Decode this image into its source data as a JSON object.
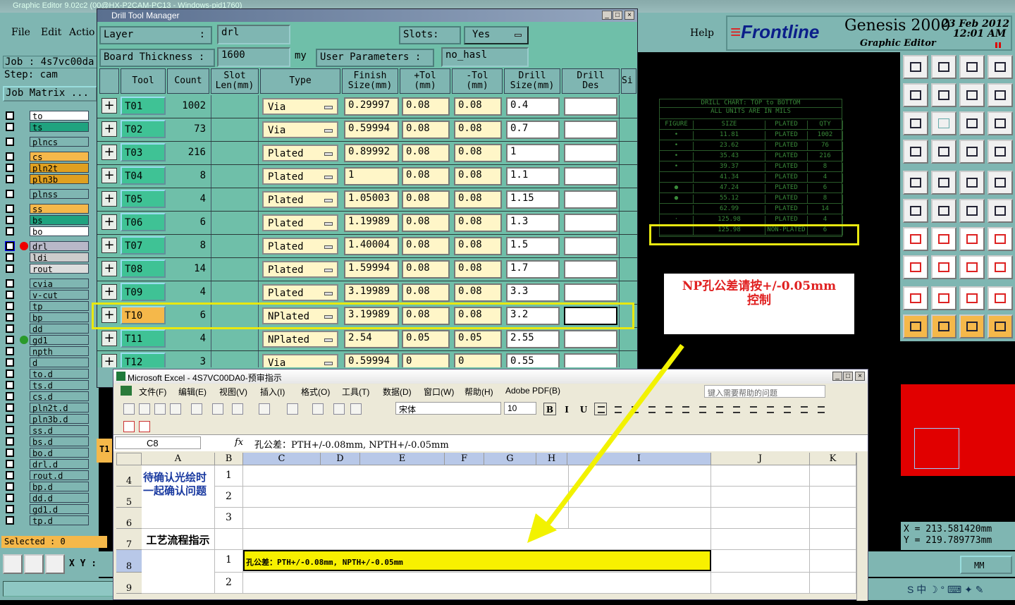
{
  "genesis": {
    "title": "Graphic Editor 9.02c2 (00@HX-P2CAM-PC13 - Windows-pid1760)",
    "menu": [
      "File",
      "Edit",
      "Actio"
    ],
    "help": "Help",
    "brand": {
      "logo": "Frontline",
      "product": "Genesis 2000",
      "sub": "Graphic Editor",
      "date": "23 Feb 2012",
      "time": "12:01 AM"
    },
    "job": "Job : 4s7vc00da",
    "step": "Step: cam",
    "job_matrix": "Job Matrix ...",
    "layers": [
      "to",
      "ts",
      "plncs",
      "cs",
      "pln2t",
      "pln3b",
      "plnss",
      "ss",
      "bs",
      "bo",
      "drl",
      "ldi",
      "rout",
      "cvia",
      "v-cut",
      "tp",
      "bp",
      "dd",
      "gd1",
      "npth",
      "d",
      "to.d",
      "ts.d",
      "cs.d",
      "pln2t.d",
      "pln3b.d",
      "ss.d",
      "bs.d",
      "bo.d",
      "drl.d",
      "rout.d",
      "bp.d",
      "dd.d",
      "gd1.d",
      "tp.d"
    ],
    "selected": "Selected : 0",
    "xy_label": "X Y :",
    "coords": {
      "x": "X  =  213.581420mm",
      "y": "Y  =  219.789773mm"
    },
    "units": "MM"
  },
  "drill_manager": {
    "title": "Drill Tool Manager",
    "layer_label": "Layer",
    "layer_value": "drl",
    "slots_label": "Slots:",
    "slots_value": "Yes",
    "thickness_label": "Board Thickness :",
    "thickness_value": "1600",
    "thickness_unit": "my",
    "params_label": "User Parameters :",
    "params_value": "no_hasl",
    "headers": [
      "Tool",
      "Count",
      "Slot Len(mm)",
      "Type",
      "Finish Size(mm)",
      "+Tol (mm)",
      "-Tol (mm)",
      "Drill Size(mm)",
      "Drill Des",
      "Si"
    ],
    "rows": [
      {
        "tool": "T01",
        "count": "1002",
        "type": "Via",
        "finish": "0.29997",
        "ptol": "0.08",
        "ntol": "0.08",
        "drill": "0.4"
      },
      {
        "tool": "T02",
        "count": "73",
        "type": "Via",
        "finish": "0.59994",
        "ptol": "0.08",
        "ntol": "0.08",
        "drill": "0.7"
      },
      {
        "tool": "T03",
        "count": "216",
        "type": "Plated",
        "finish": "0.89992",
        "ptol": "0.08",
        "ntol": "0.08",
        "drill": "1"
      },
      {
        "tool": "T04",
        "count": "8",
        "type": "Plated",
        "finish": "1",
        "ptol": "0.08",
        "ntol": "0.08",
        "drill": "1.1"
      },
      {
        "tool": "T05",
        "count": "4",
        "type": "Plated",
        "finish": "1.05003",
        "ptol": "0.08",
        "ntol": "0.08",
        "drill": "1.15"
      },
      {
        "tool": "T06",
        "count": "6",
        "type": "Plated",
        "finish": "1.19989",
        "ptol": "0.08",
        "ntol": "0.08",
        "drill": "1.3"
      },
      {
        "tool": "T07",
        "count": "8",
        "type": "Plated",
        "finish": "1.40004",
        "ptol": "0.08",
        "ntol": "0.08",
        "drill": "1.5"
      },
      {
        "tool": "T08",
        "count": "14",
        "type": "Plated",
        "finish": "1.59994",
        "ptol": "0.08",
        "ntol": "0.08",
        "drill": "1.7"
      },
      {
        "tool": "T09",
        "count": "4",
        "type": "Plated",
        "finish": "3.19989",
        "ptol": "0.08",
        "ntol": "0.08",
        "drill": "3.3"
      },
      {
        "tool": "T10",
        "count": "6",
        "type": "NPlated",
        "finish": "3.19989",
        "ptol": "0.08",
        "ntol": "0.08",
        "drill": "3.2"
      },
      {
        "tool": "T11",
        "count": "4",
        "type": "NPlated",
        "finish": "2.54",
        "ptol": "0.05",
        "ntol": "0.05",
        "drill": "2.55"
      },
      {
        "tool": "T12",
        "count": "3",
        "type": "Via",
        "finish": "0.59994",
        "ptol": "0",
        "ntol": "0",
        "drill": "0.55"
      }
    ]
  },
  "drill_chart": {
    "title1": "DRILL CHART: TOP to BOTTOM",
    "title2": "ALL UNITS ARE IN MILS",
    "headers": [
      "FIGURE",
      "SIZE",
      "PLATED",
      "QTY"
    ],
    "rows": [
      [
        "•",
        "11.81",
        "PLATED",
        "1002"
      ],
      [
        "•",
        "23.62",
        "PLATED",
        "76"
      ],
      [
        "•",
        "35.43",
        "PLATED",
        "216"
      ],
      [
        "•",
        "39.37",
        "PLATED",
        "8"
      ],
      [
        "",
        "41.34",
        "PLATED",
        "4"
      ],
      [
        "●",
        "47.24",
        "PLATED",
        "6"
      ],
      [
        "●",
        "55.12",
        "PLATED",
        "8"
      ],
      [
        "",
        "62.99",
        "PLATED",
        "14"
      ],
      [
        "·",
        "125.98",
        "PLATED",
        "4"
      ],
      [
        "",
        "125.98",
        "NON-PLATED",
        "6"
      ]
    ]
  },
  "note": {
    "line1": "NP孔公差请按+/-0.05mm",
    "line2": "控制"
  },
  "excel": {
    "title": "Microsoft Excel - 4S7VC00DA0-预审指示",
    "menu": [
      "文件(F)",
      "编辑(E)",
      "视图(V)",
      "插入(I)",
      "格式(O)",
      "工具(T)",
      "数据(D)",
      "窗口(W)",
      "帮助(H)",
      "Adobe PDF(B)"
    ],
    "help_placeholder": "键入需要帮助的问题",
    "font": "宋体",
    "size": "10",
    "cell_ref": "C8",
    "fx": "fx",
    "formula": "孔公差：PTH+/-0.08mm, NPTH+/-0.05mm",
    "columns": [
      "A",
      "B",
      "C",
      "D",
      "E",
      "F",
      "G",
      "H",
      "I",
      "J",
      "K"
    ],
    "rows": [
      "4",
      "5",
      "6",
      "7",
      "8",
      "9"
    ],
    "a4": "待确认光绘时一起确认问题",
    "a7": "工艺流程指示",
    "b": [
      "1",
      "2",
      "3",
      "",
      "1",
      "2"
    ],
    "c8": "孔公差：PTH+/-0.08mm, NPTH+/-0.05mm"
  }
}
